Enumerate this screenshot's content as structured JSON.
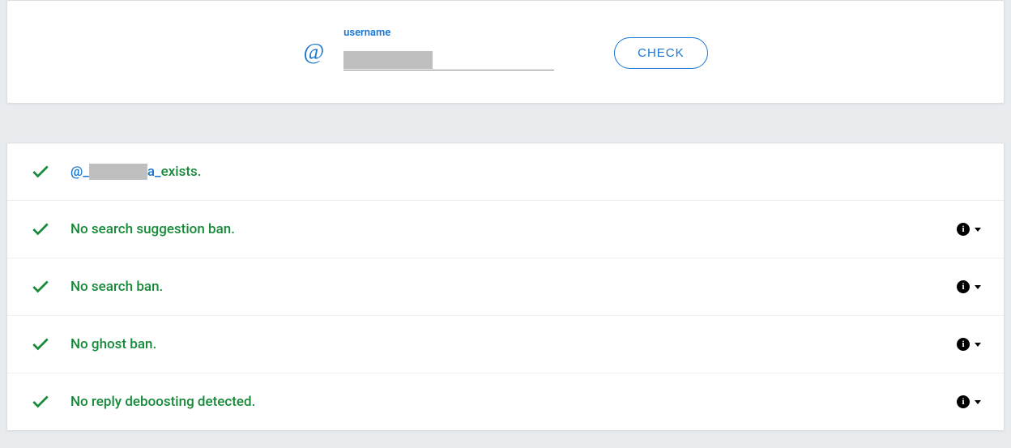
{
  "form": {
    "at": "@",
    "label": "username",
    "value": "",
    "button": "CHECK"
  },
  "results": {
    "exists": {
      "prefix": "@_",
      "suffix": "a_",
      "tail": " exists."
    },
    "items": [
      {
        "text": "No search suggestion ban."
      },
      {
        "text": "No search ban."
      },
      {
        "text": "No ghost ban."
      },
      {
        "text": "No reply deboosting detected."
      }
    ]
  },
  "icons": {
    "info": "i"
  }
}
